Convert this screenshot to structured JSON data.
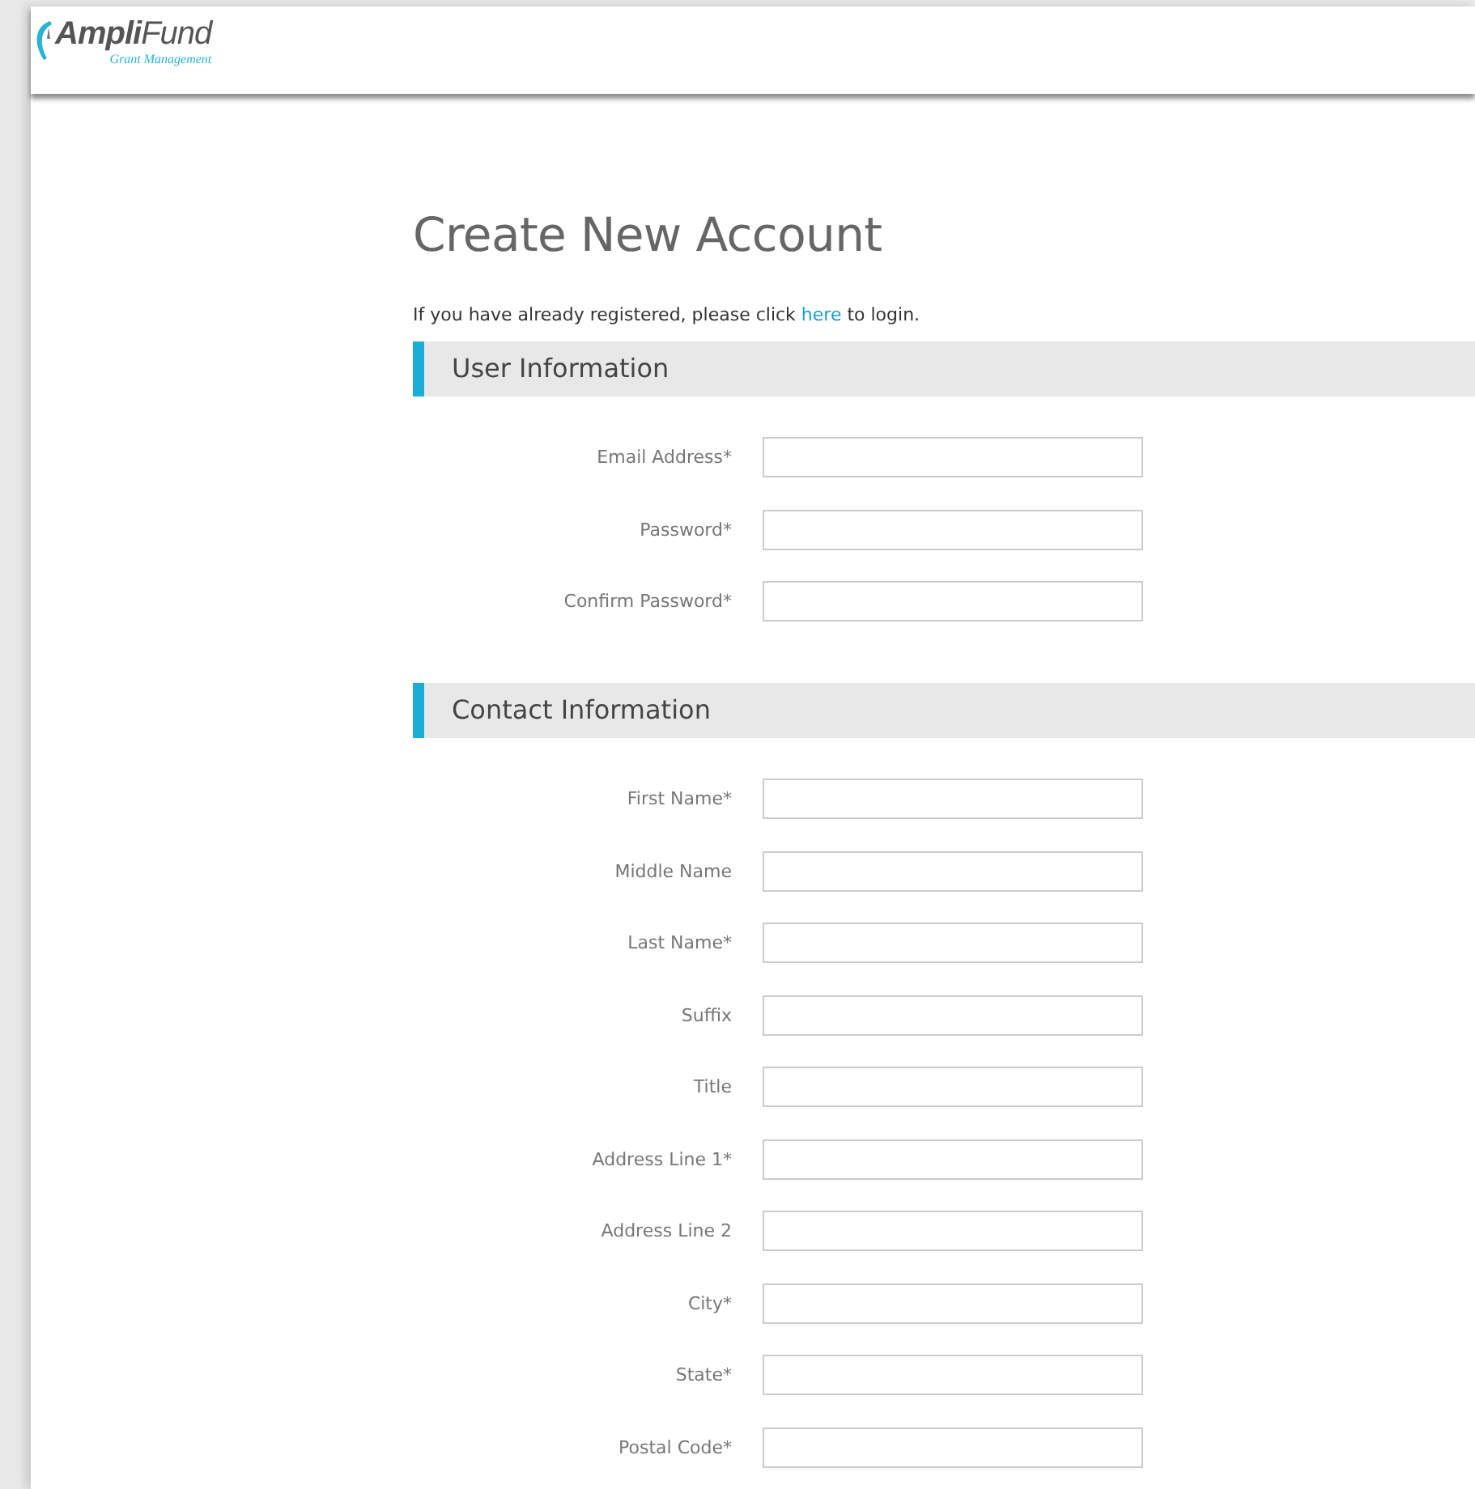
{
  "logo": {
    "name": "**Ampli**Fund",
    "tagline": "Grant Management"
  },
  "title": "Create New Account",
  "intro": {
    "before": "If you have already registered, please click ",
    "link": "here",
    "after": " to login."
  },
  "sections": [
    {
      "heading": "User Information",
      "fields": [
        {
          "label": "Email Address*"
        },
        {
          "label": "Password*"
        },
        {
          "label": "Confirm Password*"
        }
      ]
    },
    {
      "heading": "Contact Information",
      "fields": [
        {
          "label": "First Name*"
        },
        {
          "label": "Middle Name"
        },
        {
          "label": "Last Name*"
        },
        {
          "label": "Suffix"
        },
        {
          "label": "Title"
        },
        {
          "label": "Address Line 1*"
        },
        {
          "label": "Address Line 2"
        },
        {
          "label": "City*"
        },
        {
          "label": "State*"
        },
        {
          "label": "Postal Code*"
        }
      ]
    }
  ]
}
